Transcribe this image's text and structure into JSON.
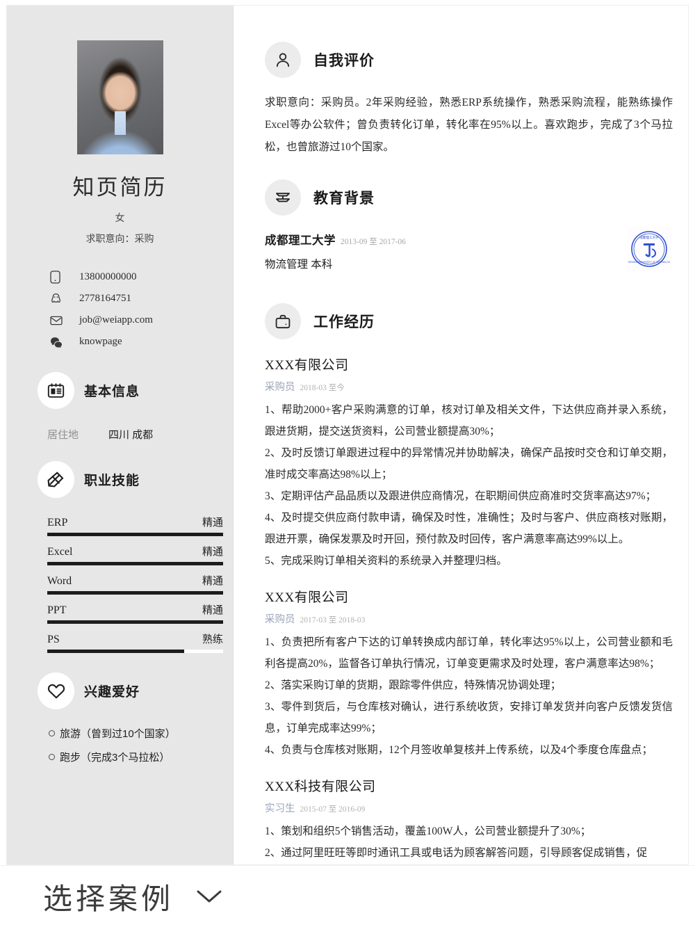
{
  "profile": {
    "name": "知页简历",
    "gender": "女",
    "intent": "求职意向：采购",
    "photo_alt": "profile-photo"
  },
  "contacts": [
    {
      "icon": "phone-icon",
      "value": "13800000000"
    },
    {
      "icon": "qq-icon",
      "value": "2778164751"
    },
    {
      "icon": "email-icon",
      "value": "job@weiapp.com"
    },
    {
      "icon": "wechat-icon",
      "value": "knowpage"
    }
  ],
  "sidebar_sections": {
    "basic": {
      "title": "基本信息",
      "icon": "id-card-icon",
      "rows": [
        {
          "label": "居住地",
          "value": "四川 成都"
        }
      ]
    },
    "skills": {
      "title": "职业技能",
      "icon": "pencil-ruler-icon",
      "items": [
        {
          "name": "ERP",
          "level": "精通",
          "percent": 100
        },
        {
          "name": "Excel",
          "level": "精通",
          "percent": 100
        },
        {
          "name": "Word",
          "level": "精通",
          "percent": 100
        },
        {
          "name": "PPT",
          "level": "精通",
          "percent": 100
        },
        {
          "name": "PS",
          "level": "熟练",
          "percent": 78
        }
      ]
    },
    "hobbies": {
      "title": "兴趣爱好",
      "icon": "heart-icon",
      "items": [
        "旅游（曾到过10个国家）",
        "跑步（完成3个马拉松）"
      ]
    }
  },
  "main_sections": {
    "self_evaluation": {
      "title": "自我评价",
      "icon": "person-icon",
      "text": "求职意向：采购员。2年采购经验，熟悉ERP系统操作，熟悉采购流程，能熟练操作Excel等办公软件；曾负责转化订单，转化率在95%以上。喜欢跑步，完成了3个马拉松，也曾旅游过10个国家。"
    },
    "education": {
      "title": "教育背景",
      "icon": "book-icon",
      "school": "成都理工大学",
      "date": "2013-09 至 2017-06",
      "major_degree": "物流管理  本科",
      "seal_name": "成都理工大学"
    },
    "work": {
      "title": "工作经历",
      "icon": "briefcase-icon",
      "jobs": [
        {
          "company": "XXX有限公司",
          "role": "采购员",
          "date": "2018-03 至今",
          "bullets": [
            "1、帮助2000+客户采购满意的订单，核对订单及相关文件，下达供应商并录入系统，跟进货期，提交送货资料，公司营业额提高30%；",
            "2、及时反馈订单跟进过程中的异常情况并协助解决，确保产品按时交仓和订单交期，准时成交率高达98%以上；",
            "3、定期评估产品品质以及跟进供应商情况，在职期间供应商准时交货率高达97%；",
            "4、及时提交供应商付款申请，确保及时性，准确性；及时与客户、供应商核对账期，跟进开票，确保发票及时开回，预付款及时回传，客户满意率高达99%以上。",
            "5、完成采购订单相关资料的系统录入并整理归档。"
          ]
        },
        {
          "company": "XXX有限公司",
          "role": "采购员",
          "date": "2017-03 至 2018-03",
          "bullets": [
            "1、负责把所有客户下达的订单转换成内部订单，转化率达95%以上，公司营业额和毛利各提高20%，监督各订单执行情况，订单变更需求及时处理，客户满意率达98%；",
            "2、落实采购订单的货期，跟踪零件供应，特殊情况协调处理；",
            "3、零件到货后，与仓库核对确认，进行系统收货，安排订单发货并向客户反馈发货信息，订单完成率达99%；",
            "4、负责与仓库核对账期，12个月签收单复核并上传系统，以及4个季度仓库盘点；"
          ]
        },
        {
          "company": "XXX科技有限公司",
          "role": "实习生",
          "date": "2015-07 至 2016-09",
          "bullets": [
            "1、策划和组织5个销售活动，覆盖100W人，公司营业额提升了30%；",
            "2、通过阿里旺旺等即时通讯工具或电话为顾客解答问题，引导顾客促成销售，促"
          ]
        }
      ]
    }
  },
  "bottom_bar": {
    "label": "选择案例",
    "chevron_icon": "chevron-down-icon"
  },
  "colors": {
    "sidebar_bg": "#e7e7e7",
    "main_bg": "#ffffff",
    "badge_bg": "#ececec",
    "text_primary": "#1c1c1c",
    "text_muted": "#9aa4b8",
    "seal_blue": "#2f4fd0"
  }
}
